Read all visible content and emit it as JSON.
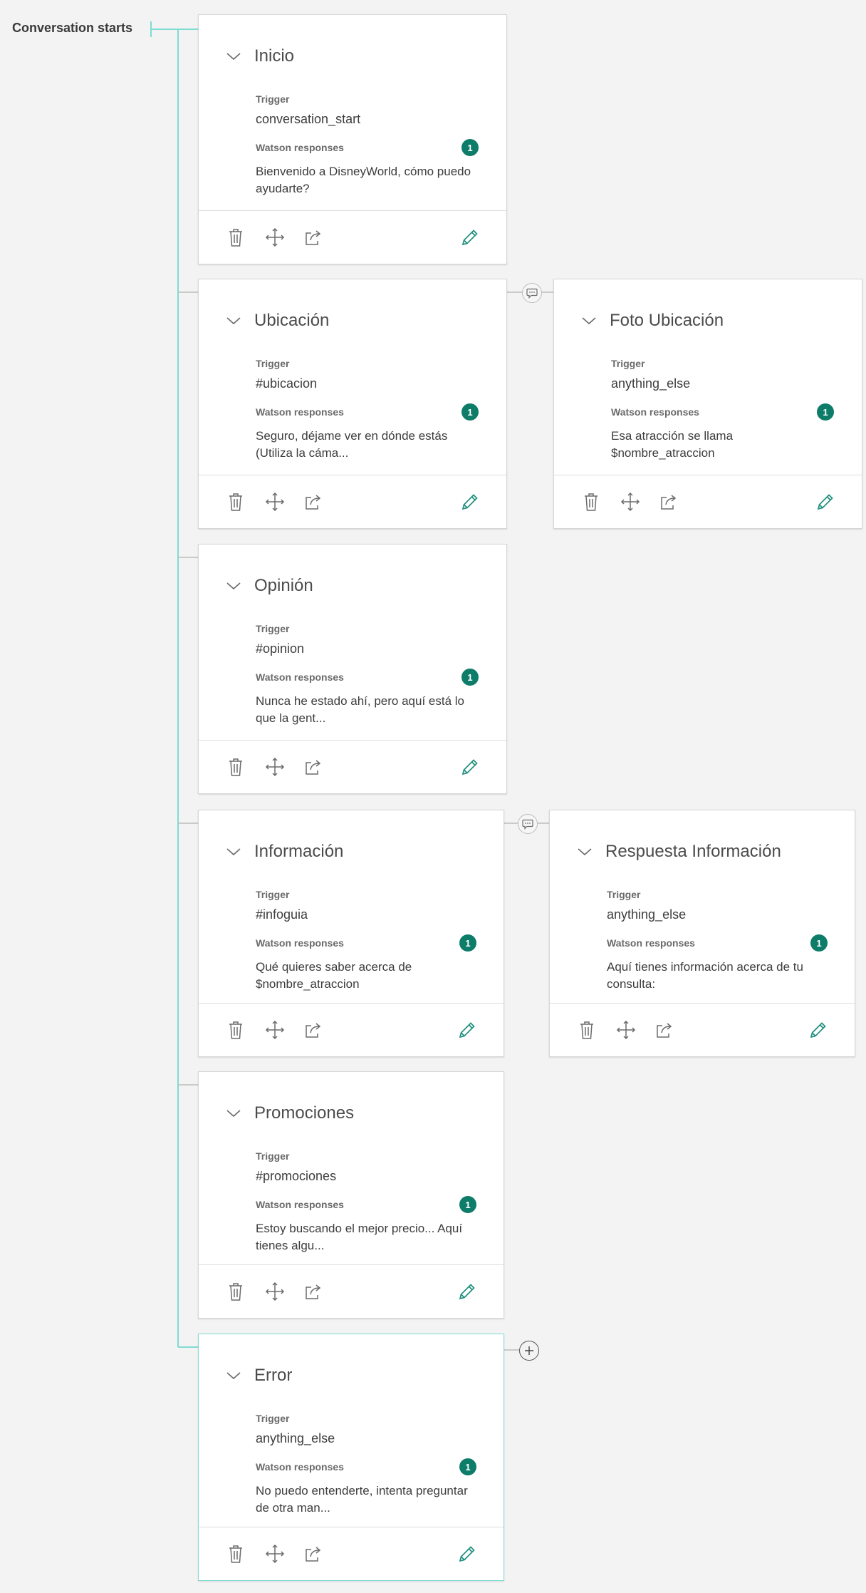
{
  "tree": {
    "root_label": "Conversation starts"
  },
  "labels": {
    "trigger": "Trigger",
    "responses": "Watson responses"
  },
  "nodes": [
    {
      "title": "Inicio",
      "trigger": "conversation_start",
      "count": "1",
      "response": "Bienvenido a DisneyWorld, cómo puedo ayudarte?"
    },
    {
      "title": "Ubicación",
      "trigger": "#ubicacion",
      "count": "1",
      "response": "Seguro, déjame ver en dónde estás (Utiliza la cáma..."
    },
    {
      "title": "Foto Ubicación",
      "trigger": "anything_else",
      "count": "1",
      "response": "Esa atracción se llama $nombre_atraccion"
    },
    {
      "title": "Opinión",
      "trigger": "#opinion",
      "count": "1",
      "response": "Nunca he estado ahí, pero aquí está lo que la gent..."
    },
    {
      "title": "Información",
      "trigger": "#infoguia",
      "count": "1",
      "response": "Qué quieres saber acerca de $nombre_atraccion"
    },
    {
      "title": "Respuesta Información",
      "trigger": "anything_else",
      "count": "1",
      "response": "Aquí tienes información acerca de tu consulta:"
    },
    {
      "title": "Promociones",
      "trigger": "#promociones",
      "count": "1",
      "response": "Estoy buscando el mejor precio... Aquí tienes algu..."
    },
    {
      "title": "Error",
      "trigger": "anything_else",
      "count": "1",
      "response": "No puedo entenderte, intenta preguntar de otra man..."
    }
  ],
  "colors": {
    "accent": "#0d7c68",
    "edit_icon": "#1f8f7d",
    "tree_line": "#7fdcd2",
    "icon_gray": "#6b6b6b",
    "background": "#f3f3f3"
  },
  "icons": {
    "collapse": "chevron-down-icon",
    "delete": "trash-icon",
    "move": "move-arrows-icon",
    "jump": "jump-to-icon",
    "edit": "pencil-icon",
    "child": "chat-bubble-icon",
    "add": "plus-circle-icon"
  }
}
